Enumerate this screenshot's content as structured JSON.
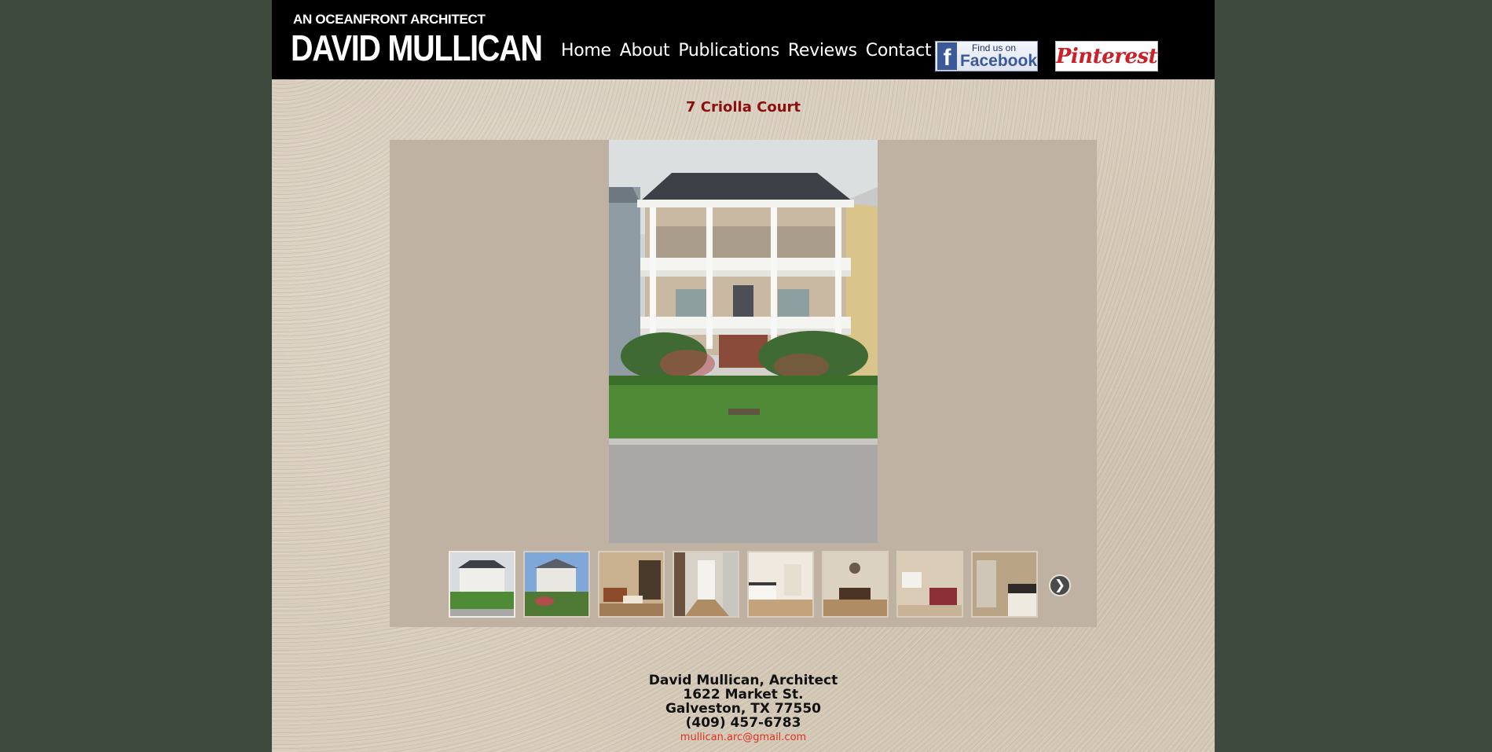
{
  "header": {
    "tagline": "AN OCEANFRONT ARCHITECT",
    "brand": "DAVID MULLICAN",
    "nav": [
      "Home",
      "About",
      "Publications",
      "Reviews",
      "Contact"
    ],
    "facebook": {
      "small": "Find us on",
      "big": "Facebook",
      "icon": "facebook-logo"
    },
    "pinterest": {
      "label": "Pinterest"
    }
  },
  "project": {
    "title": "7 Criolla Court"
  },
  "gallery": {
    "thumbnails": [
      "house-front-thumb",
      "house-rear-thumb",
      "living-room-thumb",
      "hallway-thumb",
      "kitchen-thumb",
      "dining-room-thumb",
      "bedroom-thumb",
      "bathroom-thumb"
    ],
    "next_icon": "chevron-right-icon"
  },
  "footer": {
    "name": "David Mullican, Architect",
    "street": "1622 Market St.",
    "city": "Galveston, TX 77550",
    "phone": "(409) 457-6783",
    "email": "mullican.arc@gmail.com"
  },
  "colors": {
    "page_bg": "#3e4a3e",
    "header_bg": "#000000",
    "title": "#8a1010",
    "gallery_bg": "#bfb2a2",
    "email": "#e0301e"
  }
}
